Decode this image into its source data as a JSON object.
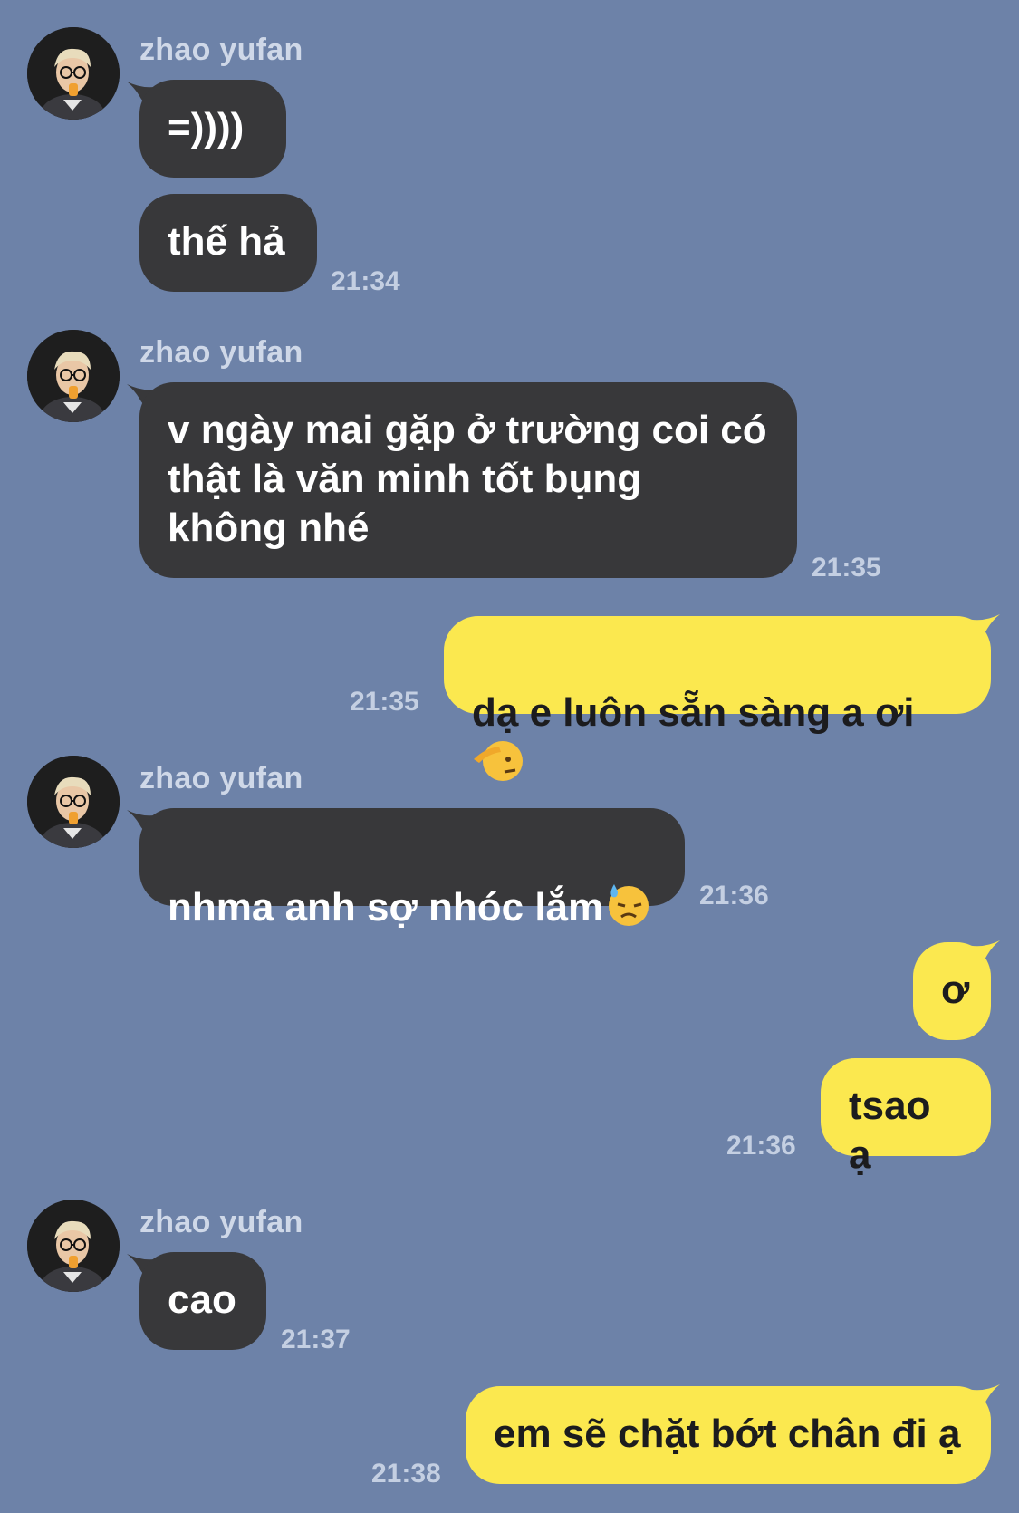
{
  "colors": {
    "background": "#6d82a8",
    "incoming_bubble": "#38383a",
    "outgoing_bubble": "#fbe84f",
    "meta_text": "#c4cfe2"
  },
  "contact": {
    "name": "zhao yufan",
    "avatar": "profile-photo"
  },
  "messages": [
    {
      "from": "them",
      "sender": "zhao yufan",
      "text": "=))))",
      "time": ""
    },
    {
      "from": "them",
      "text": "thế hả",
      "time": "21:34"
    },
    {
      "from": "them",
      "sender": "zhao yufan",
      "text": "v ngày mai gặp ở trường coi có thật là văn minh tốt bụng không nhé",
      "time": "21:35"
    },
    {
      "from": "me",
      "text": "dạ e luôn sẵn sàng a ơi",
      "emoji": "saluting-face",
      "time": "21:35"
    },
    {
      "from": "them",
      "sender": "zhao yufan",
      "text": "nhma anh sợ nhóc lắm",
      "emoji": "downcast-face-with-sweat",
      "time": "21:36"
    },
    {
      "from": "me",
      "text": "ơ",
      "time": ""
    },
    {
      "from": "me",
      "text": "tsao ạ",
      "time": "21:36"
    },
    {
      "from": "them",
      "sender": "zhao yufan",
      "text": "cao",
      "time": "21:37"
    },
    {
      "from": "me",
      "text": "em sẽ chặt bớt chân đi ạ",
      "time": "21:38"
    }
  ]
}
